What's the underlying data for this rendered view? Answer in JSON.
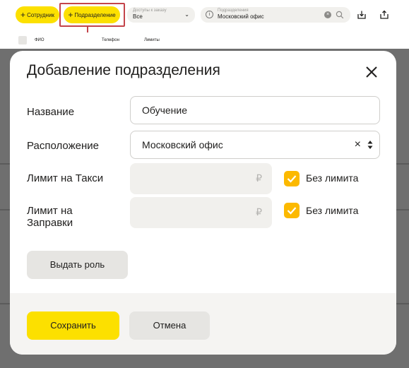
{
  "toolbar": {
    "add_employee": "Сотрудник",
    "add_division": "Подразделение",
    "access_label": "Доступы к заказу",
    "access_value": "Все",
    "division_label": "Подразделения",
    "division_value": "Московский офис"
  },
  "table": {
    "columns": [
      "ФИО",
      "Телефон",
      "Лимиты"
    ]
  },
  "modal": {
    "title": "Добавление подразделения",
    "fields": {
      "name_label": "Название",
      "name_value": "Обучение",
      "location_label": "Расположение",
      "location_value": "Московский офис",
      "taxi_limit_label": "Лимит на Такси",
      "fuel_limit_label": "Лимит на Заправки",
      "currency": "₽",
      "no_limit": "Без лимита"
    },
    "role_button": "Выдать роль",
    "save_button": "Сохранить",
    "cancel_button": "Отмена"
  },
  "colors": {
    "accent_yellow": "#fce000",
    "checkbox_orange": "#fcb900",
    "highlight_red": "#c4444a"
  }
}
